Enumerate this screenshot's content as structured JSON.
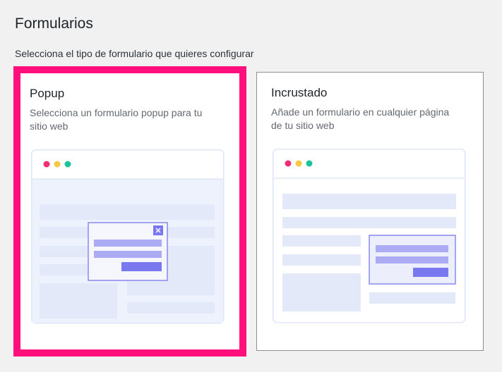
{
  "header": {
    "title": "Formularios",
    "subtitle": "Selecciona el tipo de formulario que quieres configurar"
  },
  "cards": [
    {
      "title": "Popup",
      "description": "Selecciona un formulario popup para tu sitio web",
      "selected": true,
      "illustration_icon": "popup-form-illustration-icon"
    },
    {
      "title": "Incrustado",
      "description": "Añade un formulario en cualquier página de tu sitio web",
      "selected": false,
      "illustration_icon": "embedded-form-illustration-icon"
    }
  ],
  "colors": {
    "selected_border": "#ff0f7b",
    "dot_red": "#ef2f73",
    "dot_yellow": "#f7c844",
    "dot_green": "#1cc29b",
    "accent_purple": "#7a78ef",
    "light_purple": "#ababf3",
    "illustration_bg": "#eef2fc"
  }
}
